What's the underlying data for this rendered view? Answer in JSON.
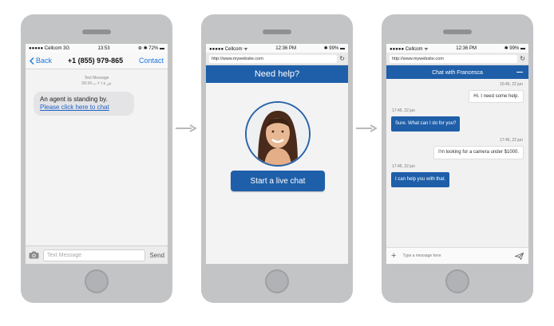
{
  "phone1": {
    "status": {
      "carrier": "●●●●● Cellcom  3G",
      "time": "13:53",
      "battery": "⊕ ✱ 72% ▬"
    },
    "nav": {
      "back": "Back",
      "number": "+1 (855) 979-865",
      "contact": "Contact"
    },
    "meta": {
      "label": "Text Message",
      "time": "09:34 ﻿‏ﺵ‏ ٥ ﺎ‏ ٢ ﺏ"
    },
    "message": {
      "text": "An agent is standing by.",
      "link": "Please click here to chat"
    },
    "input": {
      "placeholder": "Text Message",
      "send": "Send",
      "icon": "camera-icon"
    }
  },
  "phone2": {
    "status": {
      "carrier": "●●●●● Cellcom ᯤ",
      "time": "12:36 PM",
      "battery": "✱ 99% ▬"
    },
    "url": "http://www.mywebsite.com",
    "title": "Need help?",
    "button": "Start a live chat",
    "colors": {
      "accent": "#1f5fa9"
    }
  },
  "phone3": {
    "status": {
      "carrier": "●●●●● Cellcom ᯤ",
      "time": "12:36 PM",
      "battery": "✱ 99% ▬"
    },
    "url": "http://www.mywebsite.com",
    "header": "Chat with Francesca",
    "messages": [
      {
        "side": "out",
        "time": "16:45, 22 jun",
        "text": "Hi. I need some help."
      },
      {
        "side": "in",
        "time": "17:45, 22 jun",
        "text": "Sure. What can I do for you?"
      },
      {
        "side": "out",
        "time": "17:45, 22 jun",
        "text": "I'm looking for a camera under $1000."
      },
      {
        "side": "in",
        "time": "17:45, 22 jun",
        "text": "I can help you with that."
      }
    ],
    "input": {
      "placeholder": "Type a message here",
      "icon_left": "plus-icon",
      "icon_right": "send-icon"
    }
  }
}
